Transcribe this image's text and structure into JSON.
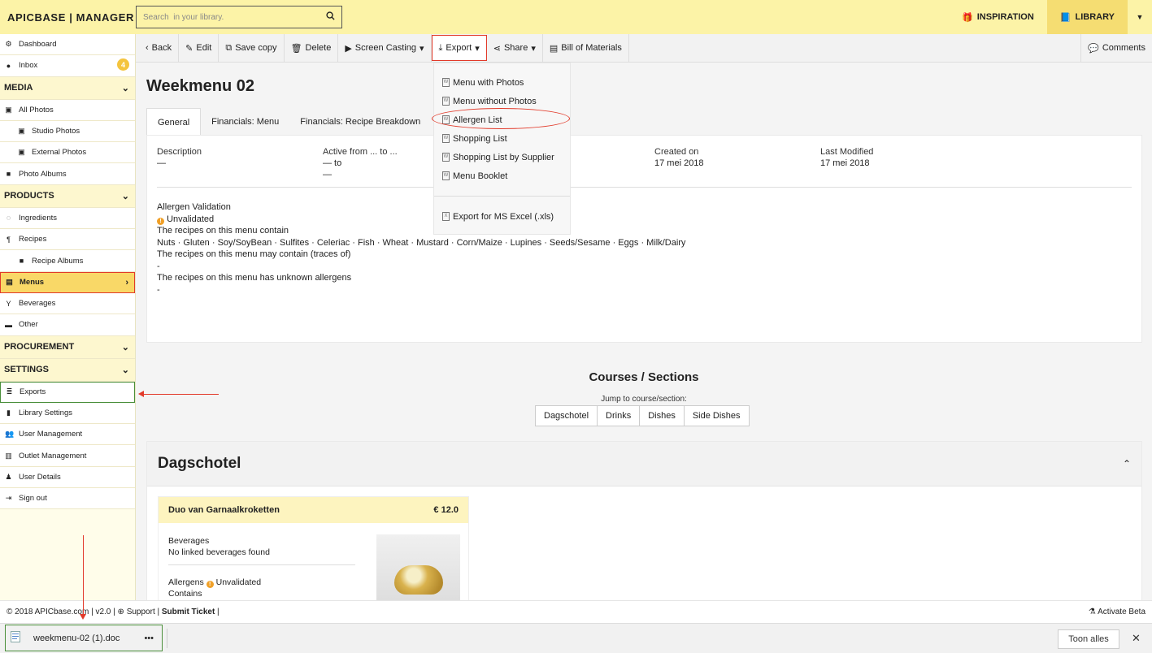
{
  "header": {
    "brand": "APICBASE | MANAGER",
    "search_placeholder": "Search  in your library.",
    "inspiration": "INSPIRATION",
    "library": "LIBRARY"
  },
  "sidebar": {
    "dashboard": "Dashboard",
    "inbox": "Inbox",
    "inbox_badge": "4",
    "media": "MEDIA",
    "all_photos": "All Photos",
    "studio_photos": "Studio Photos",
    "external_photos": "External Photos",
    "photo_albums": "Photo Albums",
    "products": "PRODUCTS",
    "ingredients": "Ingredients",
    "recipes": "Recipes",
    "recipe_albums": "Recipe Albums",
    "menus": "Menus",
    "beverages": "Beverages",
    "other": "Other",
    "procurement": "PROCUREMENT",
    "settings": "SETTINGS",
    "exports": "Exports",
    "library_settings": "Library Settings",
    "user_management": "User Management",
    "outlet_management": "Outlet Management",
    "user_details": "User Details",
    "sign_out": "Sign out"
  },
  "toolbar": {
    "back": "Back",
    "edit": "Edit",
    "save_copy": "Save copy",
    "delete": "Delete",
    "screen_casting": "Screen Casting",
    "export": "Export",
    "share": "Share",
    "bom": "Bill of Materials",
    "comments": "Comments"
  },
  "export_menu": {
    "items": [
      "Menu with Photos",
      "Menu without Photos",
      "Allergen List",
      "Shopping List",
      "Shopping List by Supplier",
      "Menu Booklet"
    ],
    "excel": "Export for MS Excel (.xls)"
  },
  "page": {
    "title": "Weekmenu 02",
    "tabs": [
      "General",
      "Financials: Menu",
      "Financials: Recipe Breakdown"
    ],
    "description_label": "Description",
    "description_value": "—",
    "active_label": "Active from ... to ...",
    "active_value": "— to",
    "active_value2": "—",
    "created_label": "Created on",
    "created_value": "17 mei 2018",
    "modified_label": "Last Modified",
    "modified_value": "17 mei 2018",
    "allergen_validation": "Allergen Validation",
    "unvalidated": "Unvalidated",
    "contain_label": "The recipes on this menu contain",
    "allergens": "Nuts · Gluten · Soy/SoyBean · Sulfites · Celeriac · Fish · Wheat · Mustard · Corn/Maize · Lupines · Seeds/Sesame · Eggs · Milk/Dairy",
    "may_contain_label": "The recipes on this menu may contain (traces of)",
    "may_contain_value": "-",
    "unknown_label": "The recipes on this menu has unknown allergens",
    "unknown_value": "-"
  },
  "courses": {
    "title": "Courses / Sections",
    "jump_label": "Jump to course/section:",
    "buttons": [
      "Dagschotel",
      "Drinks",
      "Dishes",
      "Side Dishes"
    ],
    "section_title": "Dagschotel",
    "dish_name": "Duo van Garnaalkroketten",
    "dish_price": "€ 12.0",
    "beverages_label": "Beverages",
    "beverages_value": "No linked beverages found",
    "allergens_label": "Allergens",
    "allergens_status": "Unvalidated",
    "contains_label": "Contains"
  },
  "footer": {
    "copyright": "© 2018 APICbase.com | v2.0 |",
    "support": "Support",
    "submit_ticket": "Submit Ticket",
    "activate_beta": "Activate Beta"
  },
  "downloads": {
    "file": "weekmenu-02 (1).doc",
    "show_all": "Toon alles"
  },
  "colors": {
    "header_bg": "#fcf3a7",
    "accent": "#f5dd72",
    "annotation": "#e23a2a",
    "highlight_green": "#4a8f3a"
  }
}
